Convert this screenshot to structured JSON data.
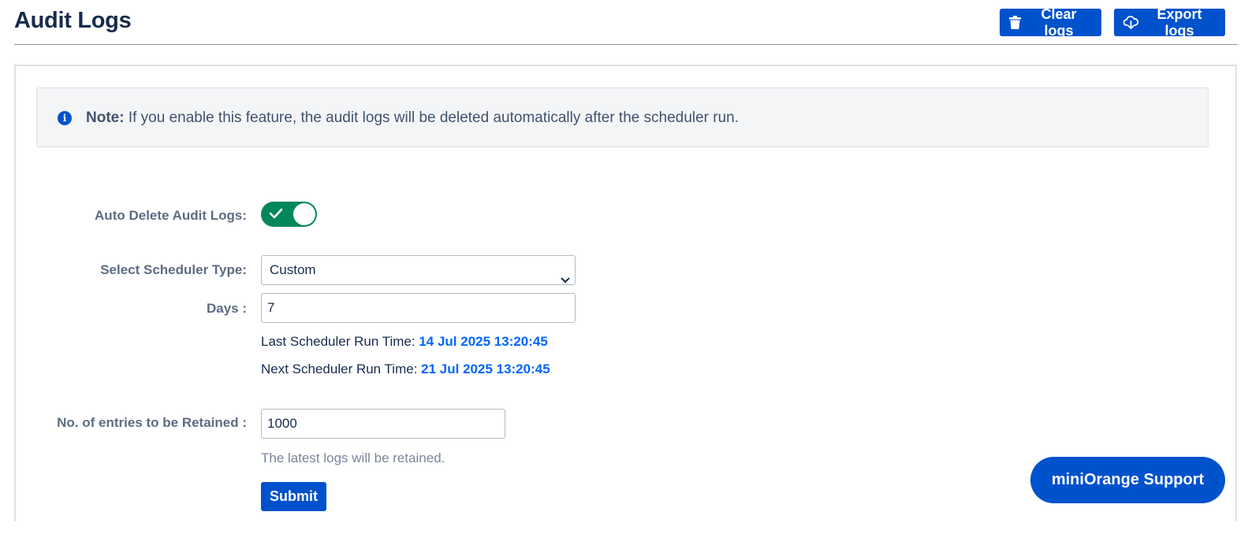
{
  "header": {
    "title": "Audit Logs",
    "clear_label": "Clear logs",
    "export_label": "Export logs"
  },
  "note": {
    "icon": "info-icon",
    "label": "Note:",
    "text": " If you enable this feature, the audit logs will be deleted automatically after the scheduler run."
  },
  "form": {
    "auto_delete_label": "Auto Delete Audit Logs:",
    "auto_delete_enabled": true,
    "scheduler_type_label": "Select Scheduler Type:",
    "scheduler_type_value": "Custom",
    "days_label": "Days :",
    "days_value": "7",
    "last_run_label": "Last Scheduler Run Time: ",
    "last_run_value": "14 Jul 2025 13:20:45",
    "next_run_label": "Next Scheduler Run Time: ",
    "next_run_value": "21 Jul 2025 13:20:45",
    "retain_label": "No. of entries to be Retained :",
    "retain_value": "1000",
    "retain_hint": "The latest logs will be retained.",
    "submit_label": "Submit"
  },
  "support": {
    "label": "miniOrange Support"
  },
  "colors": {
    "primary": "#0052cc",
    "toggle_on": "#00875a",
    "timestamp": "#0065ff"
  }
}
